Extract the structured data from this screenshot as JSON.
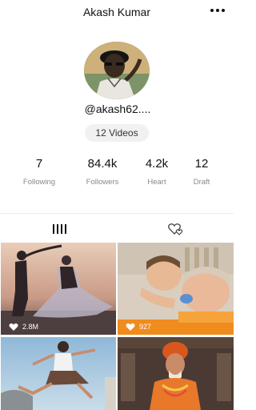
{
  "header": {
    "title": "Akash Kumar",
    "more_icon": "more-dots-icon"
  },
  "profile": {
    "handle": "@akash62....",
    "videos_label": "12 Videos"
  },
  "stats": [
    {
      "value": "7",
      "label": "Following"
    },
    {
      "value": "84.4k",
      "label": "Followers"
    },
    {
      "value": "4.2k",
      "label": "Heart"
    },
    {
      "value": "12",
      "label": "Draft"
    }
  ],
  "tabs": [
    {
      "icon": "grid-bars-icon"
    },
    {
      "icon": "liked-hearts-icon"
    }
  ],
  "videos": [
    {
      "likes": "2.8M"
    },
    {
      "likes": "927"
    },
    {
      "likes": ""
    },
    {
      "likes": ""
    }
  ],
  "colors": {
    "heart": "#ffffff",
    "muted": "#888888"
  }
}
